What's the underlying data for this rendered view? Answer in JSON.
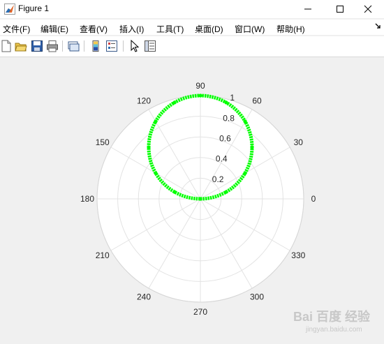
{
  "window": {
    "title": "Figure 1"
  },
  "menu": {
    "items": [
      {
        "label": "文件(F)"
      },
      {
        "label": "编辑(E)"
      },
      {
        "label": "查看(V)"
      },
      {
        "label": "插入(I)"
      },
      {
        "label": "工具(T)"
      },
      {
        "label": "桌面(D)"
      },
      {
        "label": "窗口(W)"
      },
      {
        "label": "帮助(H)"
      }
    ]
  },
  "toolbar": {
    "tools": [
      "new-figure-icon",
      "open-file-icon",
      "save-icon",
      "print-icon",
      "link-plot-icon",
      "colorbar-icon",
      "legend-icon",
      "pointer-icon",
      "property-inspector-icon"
    ]
  },
  "chart_data": {
    "type": "polar-line",
    "line_color": "#00ff00",
    "theta_ticks": [
      "0",
      "30",
      "60",
      "90",
      "120",
      "150",
      "180",
      "210",
      "240",
      "270",
      "300",
      "330"
    ],
    "r_ticks": [
      "0.2",
      "0.4",
      "0.6",
      "0.8",
      "1"
    ],
    "r_lim": [
      0,
      1
    ],
    "curve": "r = sin(theta)",
    "theta_deg": [
      0,
      15,
      30,
      45,
      60,
      75,
      90,
      105,
      120,
      135,
      150,
      165,
      180
    ],
    "r": [
      0.0,
      0.259,
      0.5,
      0.707,
      0.866,
      0.966,
      1.0,
      0.966,
      0.866,
      0.707,
      0.5,
      0.259,
      0.0
    ],
    "grid": true
  },
  "watermark": {
    "text": "Bai 百度 经验",
    "subtext": "jingyan.baidu.com"
  }
}
